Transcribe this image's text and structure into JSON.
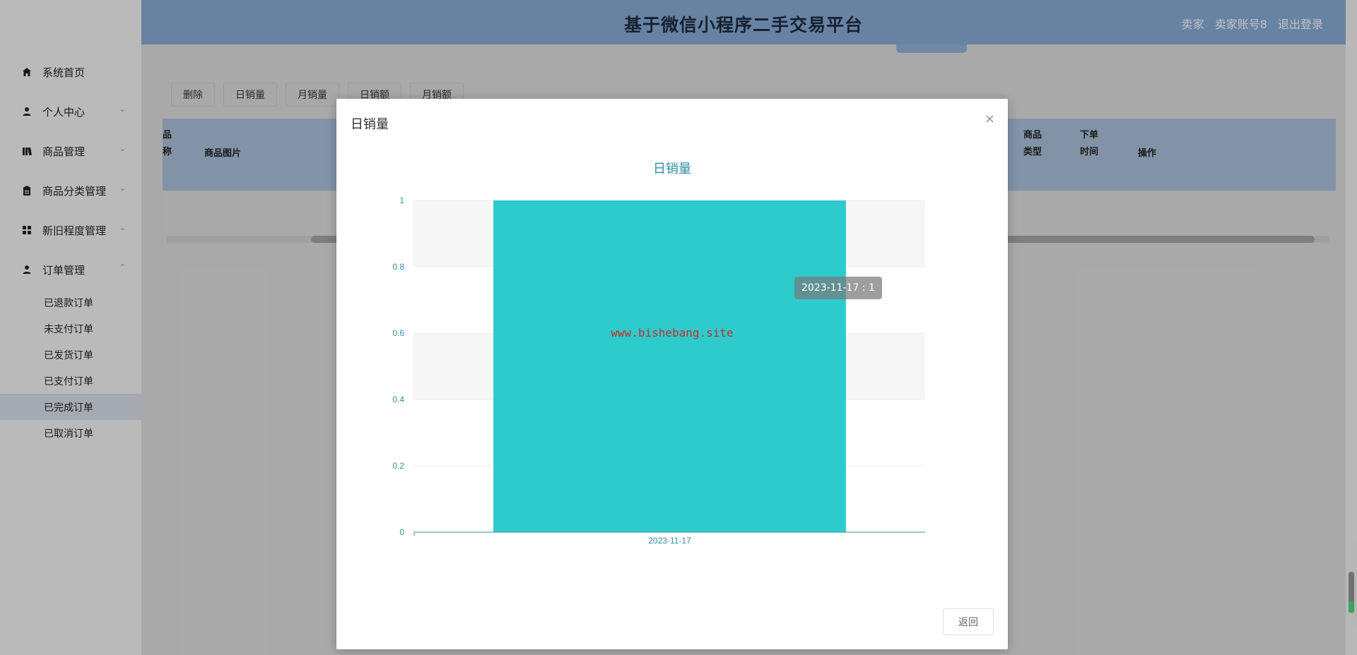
{
  "header": {
    "title": "基于微信小程序二手交易平台",
    "role": "卖家",
    "account": "卖家账号8",
    "logout": "退出登录"
  },
  "sidebar": {
    "items": [
      {
        "label": "系统首页",
        "icon": "home-icon",
        "has_children": false
      },
      {
        "label": "个人中心",
        "icon": "user-icon",
        "has_children": true
      },
      {
        "label": "商品管理",
        "icon": "book-icon",
        "has_children": true
      },
      {
        "label": "商品分类管理",
        "icon": "clipboard-icon",
        "has_children": true
      },
      {
        "label": "新旧程度管理",
        "icon": "grid-icon",
        "has_children": true
      },
      {
        "label": "订单管理",
        "icon": "user-icon",
        "has_children": true,
        "expanded": true
      }
    ],
    "order_sub": [
      {
        "label": "已退款订单"
      },
      {
        "label": "未支付订单"
      },
      {
        "label": "已发货订单"
      },
      {
        "label": "已支付订单"
      },
      {
        "label": "已完成订单",
        "active": true
      },
      {
        "label": "已取消订单"
      }
    ]
  },
  "toolbar": {
    "buttons": [
      "删除",
      "日销量",
      "月销量",
      "日销额",
      "月销额"
    ]
  },
  "table": {
    "headers": {
      "partial": "品\n称",
      "image": "商品图片",
      "type": "商品\n类型",
      "time": "下单\n时间",
      "ops": "操作"
    }
  },
  "dialog": {
    "title": "日销量",
    "close": "×",
    "return_label": "返回",
    "tooltip": "2023-11-17 : 1",
    "watermark": "www.bishebang.site"
  },
  "colors": {
    "bar": "#2ecbcd",
    "axis_text": "#2f8fa6",
    "header": "#7f9fc6"
  },
  "chart_data": {
    "type": "bar",
    "title": "日销量",
    "categories": [
      "2023-11-17"
    ],
    "values": [
      1
    ],
    "ylim": [
      0,
      1
    ],
    "yticks": [
      0,
      0.2,
      0.4,
      0.6,
      0.8,
      1
    ],
    "ytick_labels": [
      "0",
      "0.2",
      "0.4",
      "0.6",
      "0.8",
      "1"
    ],
    "grid": true,
    "xlabel": "",
    "ylabel": ""
  }
}
